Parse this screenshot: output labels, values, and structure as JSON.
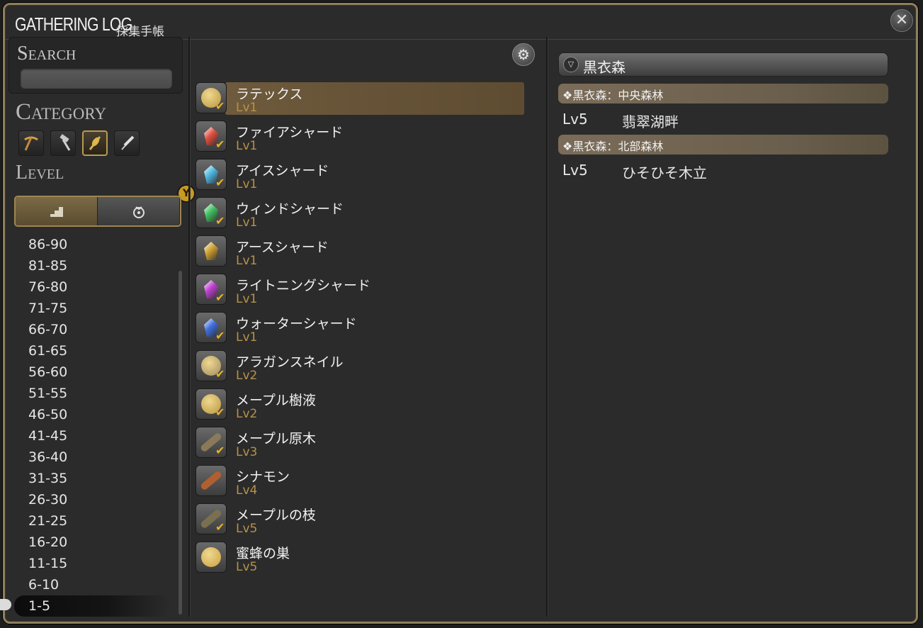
{
  "window": {
    "title": "GATHERING LOG",
    "subtitle": "採集手帳",
    "close_icon": "close-icon"
  },
  "search": {
    "label": "Search",
    "value": ""
  },
  "category": {
    "label": "Category",
    "icons": [
      "pickaxe-icon",
      "sledgehammer-icon",
      "hatchet-icon",
      "scythe-icon"
    ],
    "selected_index": 2
  },
  "level": {
    "label": "Level",
    "badge": "Y",
    "sort_buttons": [
      "level-sort-icon",
      "pouch-icon"
    ],
    "ranges": [
      "86-90",
      "81-85",
      "76-80",
      "71-75",
      "66-70",
      "61-65",
      "56-60",
      "51-55",
      "46-50",
      "41-45",
      "36-40",
      "31-35",
      "26-30",
      "21-25",
      "16-20",
      "11-15",
      "6-10",
      "1-5"
    ],
    "selected": "1-5"
  },
  "items": [
    {
      "name": "ラテックス",
      "level": "Lv1",
      "icon": "bowl-icon",
      "color": "#b8953c",
      "checked": true,
      "selected": true
    },
    {
      "name": "ファイアシャード",
      "level": "Lv1",
      "icon": "fire-shard-icon",
      "color": "#e05040",
      "checked": true
    },
    {
      "name": "アイスシャード",
      "level": "Lv1",
      "icon": "ice-shard-icon",
      "color": "#50b8e0",
      "checked": true
    },
    {
      "name": "ウィンドシャード",
      "level": "Lv1",
      "icon": "wind-shard-icon",
      "color": "#40c060",
      "checked": true
    },
    {
      "name": "アースシャード",
      "level": "Lv1",
      "icon": "earth-shard-icon",
      "color": "#d0a030",
      "checked": false
    },
    {
      "name": "ライトニングシャード",
      "level": "Lv1",
      "icon": "lightning-shard-icon",
      "color": "#c040d0",
      "checked": true
    },
    {
      "name": "ウォーターシャード",
      "level": "Lv1",
      "icon": "water-shard-icon",
      "color": "#4070e0",
      "checked": true
    },
    {
      "name": "アラガンスネイル",
      "level": "Lv2",
      "icon": "snail-icon",
      "color": "#a08a60",
      "checked": true
    },
    {
      "name": "メープル樹液",
      "level": "Lv2",
      "icon": "bowl-icon",
      "color": "#b8953c",
      "checked": true
    },
    {
      "name": "メープル原木",
      "level": "Lv3",
      "icon": "log-icon",
      "color": "#8a7a5a",
      "checked": true
    },
    {
      "name": "シナモン",
      "level": "Lv4",
      "icon": "cinnamon-icon",
      "color": "#b06030",
      "checked": false
    },
    {
      "name": "メープルの枝",
      "level": "Lv5",
      "icon": "branch-icon",
      "color": "#7a7050",
      "checked": true
    },
    {
      "name": "蜜蜂の巣",
      "level": "Lv5",
      "icon": "beehive-icon",
      "color": "#c8a040",
      "checked": false
    }
  ],
  "details": {
    "region": "黒衣森",
    "zones": [
      {
        "name": "❖黒衣森：中央森林",
        "spots": [
          {
            "level": "Lv5",
            "name": "翡翠湖畔"
          }
        ]
      },
      {
        "name": "❖黒衣森：北部森林",
        "spots": [
          {
            "level": "Lv5",
            "name": "ひそひそ木立"
          }
        ]
      }
    ]
  }
}
